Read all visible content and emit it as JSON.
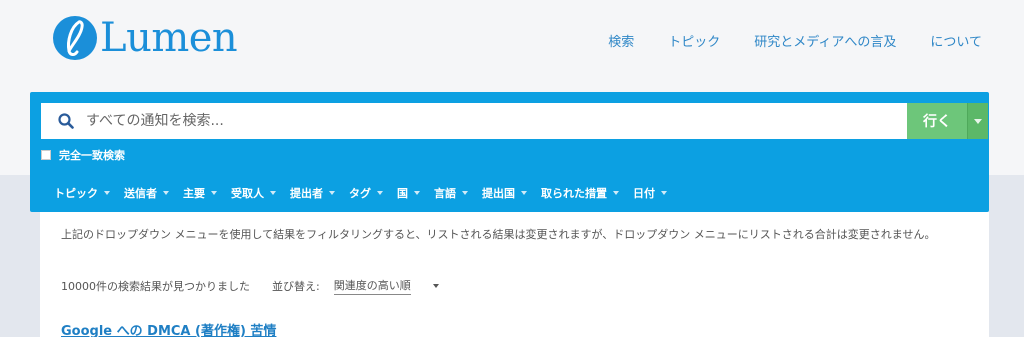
{
  "brand": {
    "name": "Lumen",
    "color": "#1b8fd9"
  },
  "nav": [
    {
      "label": "検索"
    },
    {
      "label": "トピック"
    },
    {
      "label": "研究とメディアへの言及"
    },
    {
      "label": "について"
    }
  ],
  "search": {
    "placeholder": "すべての通知を検索...",
    "value": "",
    "go_label": "行く",
    "exact_label": "完全一致検索",
    "exact_checked": false
  },
  "filters": [
    {
      "label": "トピック"
    },
    {
      "label": "送信者"
    },
    {
      "label": "主要"
    },
    {
      "label": "受取人"
    },
    {
      "label": "提出者"
    },
    {
      "label": "タグ"
    },
    {
      "label": "国"
    },
    {
      "label": "言語"
    },
    {
      "label": "提出国"
    },
    {
      "label": "取られた措置"
    },
    {
      "label": "日付"
    }
  ],
  "results": {
    "note": "上記のドロップダウン メニューを使用して結果をフィルタリングすると、リストされる結果は変更されますが、ドロップダウン メニューにリストされる合計は変更されません。",
    "count_text": "10000件の検索結果が見つかりました",
    "sort_label": "並び替え:",
    "sort_value": "関連度の高い順",
    "first_title": "Google への DMCA (著作権) 苦情"
  },
  "colors": {
    "panel": "#0ca0e2",
    "go_button": "#6dc67a",
    "link": "#1f7fc4"
  }
}
